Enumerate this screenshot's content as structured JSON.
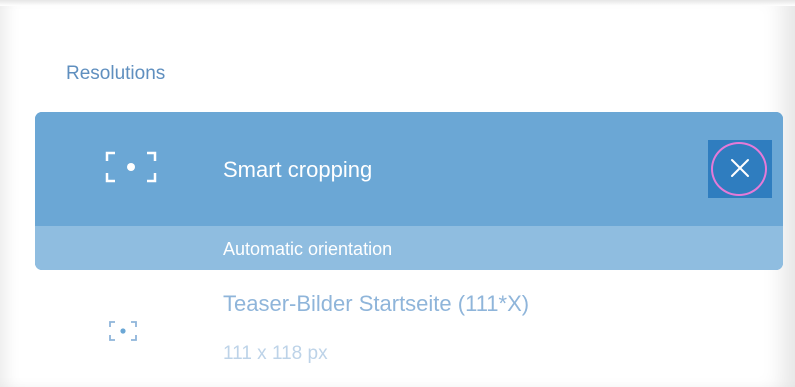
{
  "section": {
    "title": "Resolutions"
  },
  "selected_item": {
    "label": "Smart cropping",
    "sub_label": "Automatic orientation",
    "icon": "crop-focus-icon",
    "close_icon": "close-icon"
  },
  "items": [
    {
      "title": "Teaser-Bilder Startseite (111*X)",
      "size": "111 x 118 px",
      "icon": "crop-focus-icon"
    }
  ],
  "colors": {
    "accent": "#6ba7d5",
    "accent_light": "#8fbde0",
    "close_bg": "#2f7dbf",
    "highlight_ring": "#e57ad8",
    "title_text": "#5f8fbf"
  }
}
